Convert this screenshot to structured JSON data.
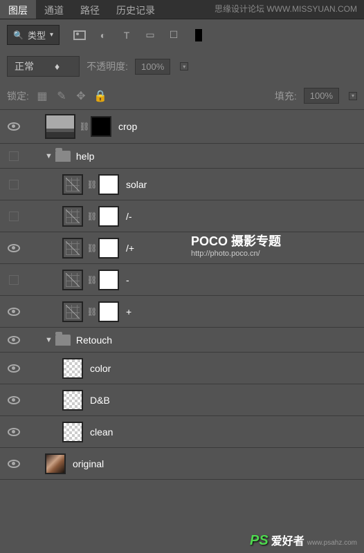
{
  "tabs": [
    "图层",
    "通道",
    "路径",
    "历史记录"
  ],
  "search_type_label": "类型",
  "blend_mode": "正常",
  "opacity_label": "不透明度:",
  "opacity_value": "100%",
  "lock_label": "锁定:",
  "fill_label": "填充:",
  "fill_value": "100%",
  "layers": {
    "crop": "crop",
    "help": "help",
    "solar": "solar",
    "slashminus": "/-",
    "slashplus": "/+",
    "minus": "-",
    "plus": "+",
    "retouch": "Retouch",
    "color": "color",
    "db": "D&B",
    "clean": "clean",
    "original": "original"
  },
  "watermark": {
    "top": "思缘设计论坛 WWW.MISSYUAN.COM",
    "main_line1": "POCO 摄影专题",
    "main_line2": "http://photo.poco.cn/",
    "bottom_ps": "PS",
    "bottom_txt": "爱好者",
    "bottom_url": "www.psahz.com"
  }
}
